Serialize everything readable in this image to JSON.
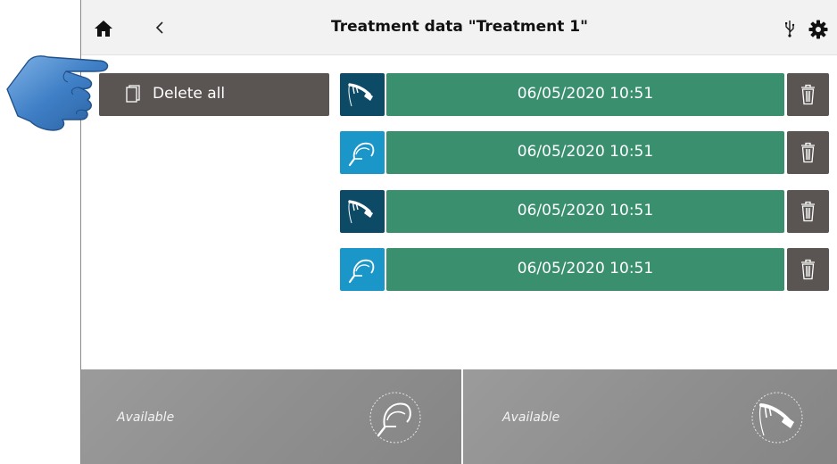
{
  "header": {
    "title": "Treatment data \"Treatment 1\""
  },
  "icons": {
    "home": "home-icon",
    "back": "chevron-left-icon",
    "usb": "usb-icon",
    "settings": "gear-icon",
    "delete_all": "document-icon",
    "row_delete": "trash-icon",
    "pointer": "pointing-hand-icon"
  },
  "actions": {
    "delete_all_label": "Delete all"
  },
  "records": [
    {
      "datetime": "06/05/2020 10:51",
      "applicator": "handpiece",
      "icon_color": "#0d4a66"
    },
    {
      "datetime": "06/05/2020 10:51",
      "applicator": "cup",
      "icon_color": "#1a96c9"
    },
    {
      "datetime": "06/05/2020 10:51",
      "applicator": "handpiece",
      "icon_color": "#0d4a66"
    },
    {
      "datetime": "06/05/2020 10:51",
      "applicator": "cup",
      "icon_color": "#1a96c9"
    }
  ],
  "slots": {
    "left": {
      "status": "Available",
      "applicator": "cup"
    },
    "right": {
      "status": "Available",
      "applicator": "handpiece"
    }
  },
  "colors": {
    "record_bar": "#3a8f6e",
    "action_dark": "#5a5452",
    "slot_bg": "#8e8e8e",
    "header_bg": "#f2f2f2"
  }
}
